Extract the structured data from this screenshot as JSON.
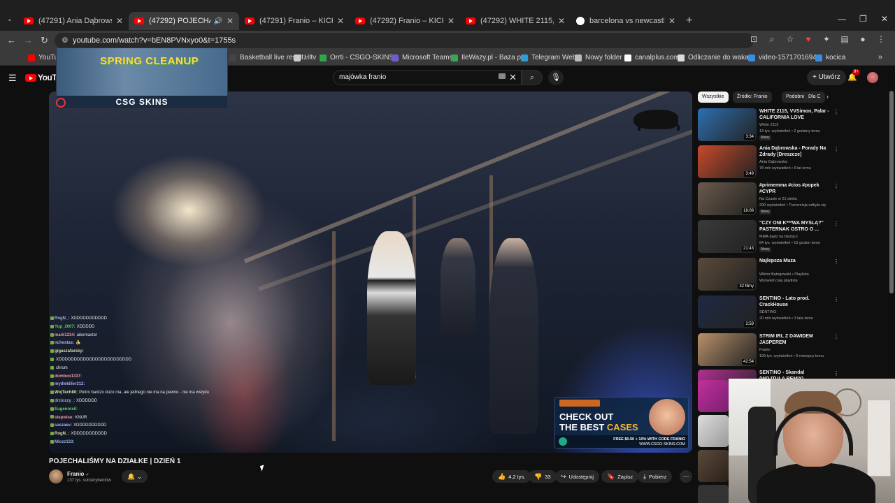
{
  "browser": {
    "tabs": [
      {
        "label": "(47291) Ania Dąbrowska - W Gł",
        "active": false,
        "icon": "youtube-icon"
      },
      {
        "label": "(47292) POJECHALIŚMY NA D",
        "active": true,
        "icon": "youtube-icon"
      },
      {
        "label": "(47291) Franio – KICK - YouTub",
        "active": false,
        "icon": "youtube-icon"
      },
      {
        "label": "(47292) Franio – KICK - YouTub",
        "active": false,
        "icon": "youtube-icon"
      },
      {
        "label": "(47292) WHITE 2115, VVSimon,",
        "active": false,
        "icon": "youtube-icon"
      },
      {
        "label": "barcelona vs newcastle - Szuka",
        "active": false,
        "icon": "google-icon"
      }
    ],
    "url": "youtube.com/watch?v=bEN8PVNxyo0&t=1755s",
    "bookmarks": [
      {
        "label": "YouTube",
        "color": "#ff0000"
      },
      {
        "label": "Basketball live result...",
        "color": "#444444"
      },
      {
        "label": "Hltv",
        "color": "#cccccc"
      },
      {
        "label": "Orrti - CSGO-SKINS...",
        "color": "#2aa84a"
      },
      {
        "label": "Microsoft Teams",
        "color": "#6b5fd0"
      },
      {
        "label": "IleWazy.pl - Baza pr...",
        "color": "#3aa655"
      },
      {
        "label": "Telegram Web",
        "color": "#2aa0da"
      },
      {
        "label": "Nowy folder",
        "color": "#bbbbbb"
      },
      {
        "label": "canalplus.com",
        "color": "#ffffff"
      },
      {
        "label": "Odliczanie do waka...",
        "color": "#dddddd"
      },
      {
        "label": "video-1571701694",
        "color": "#3a8de0"
      },
      {
        "label": "kocica",
        "color": "#3a8de0"
      }
    ]
  },
  "youtube": {
    "logo": "YouTube",
    "search_value": "majówka franio",
    "create_label": "Utwórz",
    "notifications_badge": "9+"
  },
  "video": {
    "overlay_banner_title": "SPRING CLEANUP",
    "overlay_banner_brand": "CSG SKINS",
    "chat": [
      {
        "user": "RogN_:",
        "msg": "XDDDDDDDDDDD"
      },
      {
        "user": "Yup_2007:",
        "msg": "XDDDDD"
      },
      {
        "user": "mark1234:",
        "msg": "aikemaster"
      },
      {
        "user": "nchestas:",
        "msg": "🍌"
      },
      {
        "user": "gigaszafarsky:",
        "msg": ""
      },
      {
        "user": "",
        "msg": "XDDDDDDDDDDDDDDDDDDDDDDDD"
      },
      {
        "user": "",
        "msg": "chrum"
      },
      {
        "user": "domboo1337:",
        "msg": ""
      },
      {
        "user": "mydlekiller312:",
        "msg": ""
      },
      {
        "user": "WojTech80:",
        "msg": "Petiro bardzo dużo ma, ale jednego nie ma na pewno - nie ma wstydu"
      },
      {
        "user": "drziozzy_:",
        "msg": "XDDDDDD"
      },
      {
        "user": "Eugenroxil:",
        "msg": ""
      },
      {
        "user": "stepwise:",
        "msg": "KNUR"
      },
      {
        "user": "saszaev:",
        "msg": "XDDDDDDDDDD"
      },
      {
        "user": "RogN_:",
        "msg": "XDDDDDDDDDDD"
      },
      {
        "user": "Mlozz123:",
        "msg": ""
      }
    ],
    "ad": {
      "line1": "CHECK OUT",
      "line2a": "THE BEST",
      "line2b": "CASES",
      "footer1": "FREE $0.50 + 10% WITH CODE FRANIO",
      "footer2": "WWW.CSGO-SKINS.COM"
    },
    "title": "POJECHALIŚMY NA DZIAŁKE | DZIEŃ 1",
    "channel": "Franio",
    "subscribers": "137 tys. subskrybentów",
    "likes": "4,2 tys.",
    "dislikes": "33",
    "share_label": "Udostępnij",
    "save_label": "Zapisz",
    "download_label": "Pobierz"
  },
  "sidebar": {
    "chips": [
      "Wszystkie",
      "Źródło: Franio",
      "Podobne",
      "Dla C"
    ],
    "videos": [
      {
        "title": "WHITE 2115, VVSimon, Palar - CALIFORNIA LOVE",
        "channel": "White 2115",
        "meta": "13 tys. wyświetleń • 2 godziny temu",
        "badge": "Nowy",
        "duration": "3:34",
        "color": "#2d6fb0"
      },
      {
        "title": "Ania Dąbrowska - Porady Na Zdrady [Dreszcze]",
        "channel": "Ania Dąbrowska",
        "meta": "78 mln wyświetleń • 9 lat temu",
        "badge": "",
        "duration": "3:49",
        "color": "#c84a2a"
      },
      {
        "title": "#primemma #cios #popek #CYPR",
        "channel": "Na Czasie w 21 wieku",
        "meta": "290 wyświetleń • Transmisja odbyła się",
        "badge": "Nowy",
        "duration": "18:08",
        "color": "#6a5a4a"
      },
      {
        "title": "\"CZY ONI K***WA MYŚLĄ?\" PASTERNAK OSTRO O ...",
        "channel": "MMA-bądź na bieżąco",
        "meta": "84 tys. wyświetleń • 16 godzin temu",
        "badge": "Nowy",
        "duration": "21:43",
        "color": "#3a3a3a"
      },
      {
        "title": "Najlepsza Muza",
        "channel": "Wiktor Batogowski • Playlista",
        "meta": "Wyświetl całą playlistę",
        "badge": "",
        "duration": "32 filmy",
        "color": "#5a4a3a"
      },
      {
        "title": "SENTINO - Lato prod. CrackHouse",
        "channel": "SENTINO",
        "meta": "20 mln wyświetleń • 3 lata temu",
        "badge": "",
        "duration": "2:59",
        "color": "#1e2a44"
      },
      {
        "title": "STRIM IRL Z DAWIDEM JASPEREM",
        "channel": "Franio",
        "meta": "199 tys. wyświetleń • 6 miesięcy temu",
        "badge": "",
        "duration": "42:54",
        "color": "#b8906a"
      },
      {
        "title": "SENTINO - Skandal (WOJTULA REMIX)",
        "channel": "",
        "meta": "",
        "badge": "",
        "duration": "",
        "color": "#b03090"
      }
    ]
  }
}
